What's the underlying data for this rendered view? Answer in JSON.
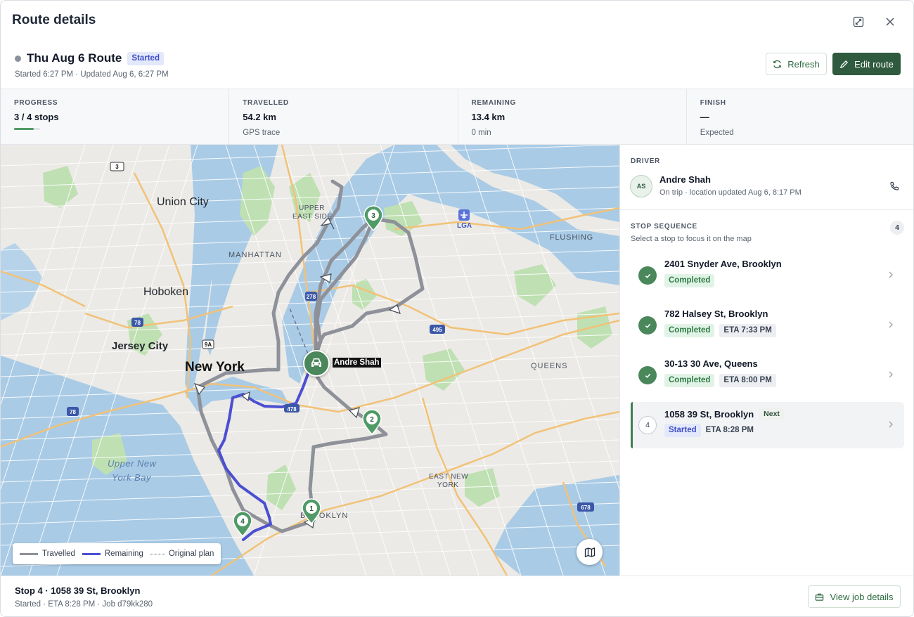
{
  "header": {
    "title": "Route details",
    "route_name": "Thu Aug 6 Route",
    "status": "Started",
    "subtitle": "Started 6:27 PM · Updated Aug 6, 6:27 PM",
    "refresh_label": "Refresh",
    "edit_label": "Edit route"
  },
  "stats": {
    "progress": {
      "label": "PROGRESS",
      "value": "3 / 4 stops",
      "fraction": 0.75
    },
    "travelled": {
      "label": "TRAVELLED",
      "value": "54.2 km",
      "sub": "GPS trace"
    },
    "remaining": {
      "label": "REMAINING",
      "value": "13.4 km",
      "sub": "0 min"
    },
    "finish": {
      "label": "FINISH",
      "value": "—",
      "sub": "Expected"
    }
  },
  "map": {
    "labels": {
      "union_city": "Union City",
      "hoboken": "Hoboken",
      "jersey_city": "Jersey City",
      "new_york": "New York",
      "manhattan": "MANHATTAN",
      "upper_east_side_1": "UPPER",
      "upper_east_side_2": "EAST SIDE",
      "lga": "LGA",
      "flushing": "FLUSHING",
      "queens": "QUEENS",
      "east_new_york_1": "EAST NEW",
      "east_new_york_2": "YORK",
      "upper_ny_bay_1": "Upper New",
      "upper_ny_bay_2": "York Bay",
      "brooklyn": "BROOKLYN",
      "hwy_3": "3",
      "hwy_78a": "78",
      "hwy_78b": "78",
      "hwy_495": "495",
      "hwy_278": "278",
      "hwy_678": "678",
      "hwy_9a": "9A",
      "hwy_478": "478"
    },
    "driver_label": "Andre Shah",
    "stop_pins": [
      "1",
      "2",
      "3",
      "4"
    ],
    "legend": {
      "travelled": "Travelled",
      "remaining": "Remaining",
      "original": "Original plan"
    },
    "colors": {
      "travelled": "#8e9199",
      "remaining": "#4b4fd1",
      "pin": "#4f9a66"
    }
  },
  "driver": {
    "section_label": "DRIVER",
    "initials": "AS",
    "name": "Andre Shah",
    "status": "On trip · location updated Aug 6, 8:17 PM"
  },
  "stops": {
    "section_label": "STOP SEQUENCE",
    "hint": "Select a stop to focus it on the map",
    "count": "4",
    "items": [
      {
        "address": "2401 Snyder Ave, Brooklyn",
        "status": "Completed",
        "eta": ""
      },
      {
        "address": "782 Halsey St, Brooklyn",
        "status": "Completed",
        "eta": "ETA 7:33 PM"
      },
      {
        "address": "30-13 30 Ave, Queens",
        "status": "Completed",
        "eta": "ETA 8:00 PM"
      },
      {
        "address": "1058 39 St, Brooklyn",
        "status": "Started",
        "eta": "ETA 8:28 PM",
        "number": "4",
        "tag": "Next"
      }
    ]
  },
  "footer": {
    "title": "Stop 4 · 1058 39 St, Brooklyn",
    "subtitle": "Started · ETA 8:28 PM · Job d79kk280",
    "button": "View job details"
  }
}
